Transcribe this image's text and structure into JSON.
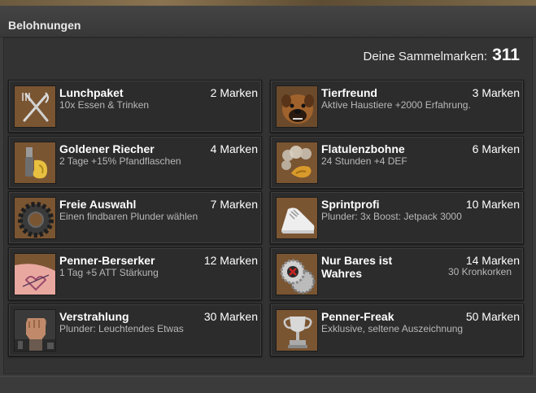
{
  "header": {
    "title": "Belohnungen"
  },
  "balance": {
    "label": "Deine Sammelmarken:",
    "value": "311"
  },
  "rewards": [
    {
      "title": "Lunchpaket",
      "cost": "2 Marken",
      "desc": "10x Essen & Trinken",
      "icon": "fork-knife-icon"
    },
    {
      "title": "Tierfreund",
      "cost": "3 Marken",
      "desc": "Aktive Haustiere +2000 Erfahrung.",
      "icon": "dog-icon"
    },
    {
      "title": "Goldener Riecher",
      "cost": "4 Marken",
      "desc": "2 Tage +15% Pfandflaschen",
      "icon": "golden-nose-icon"
    },
    {
      "title": "Flatulenzbohne",
      "cost": "6 Marken",
      "desc": "24 Stunden +4 DEF",
      "icon": "bean-icon"
    },
    {
      "title": "Freie Auswahl",
      "cost": "7 Marken",
      "desc": "Einen findbaren Plunder wählen",
      "icon": "gear-ring-icon"
    },
    {
      "title": "Sprintprofi",
      "cost": "10 Marken",
      "desc": "Plunder: 3x Boost: Jetpack 3000",
      "icon": "sneaker-icon"
    },
    {
      "title": "Penner-Berserker",
      "cost": "12 Marken",
      "desc": "1 Tag +5 ATT Stärkung",
      "icon": "tattoo-arm-icon"
    },
    {
      "title": "Nur Bares ist Wahres",
      "cost": "14 Marken",
      "desc": "30 Kronkorken",
      "icon": "bottle-cap-icon"
    },
    {
      "title": "Verstrahlung",
      "cost": "30 Marken",
      "desc": "Plunder: Leuchtendes Etwas",
      "icon": "fist-icon"
    },
    {
      "title": "Penner-Freak",
      "cost": "50 Marken",
      "desc": "Exklusive, seltene Auszeichnung",
      "icon": "trophy-icon"
    }
  ]
}
